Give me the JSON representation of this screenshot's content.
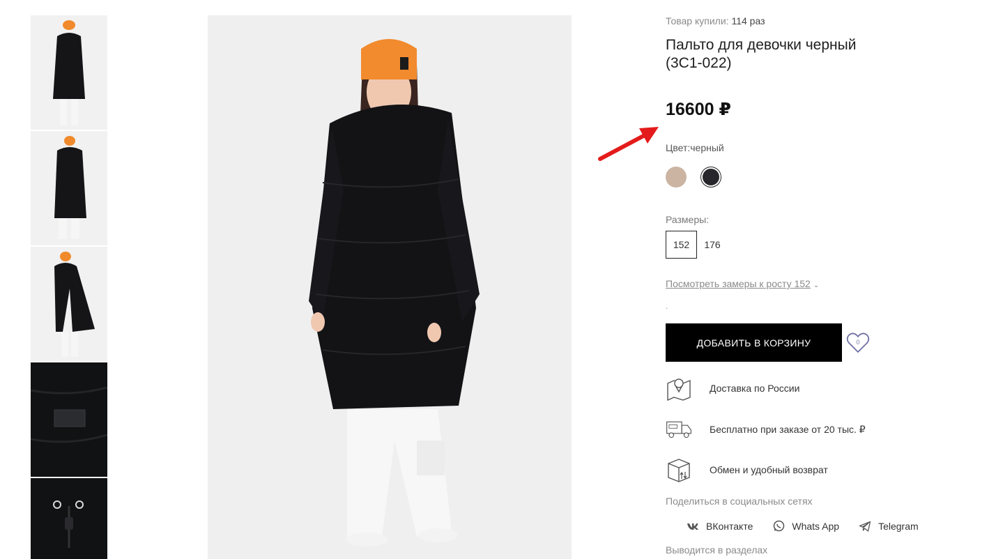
{
  "product": {
    "bought_label": "Товар купили:",
    "bought_count": "114 раз",
    "title": "Пальто для девочки черный (3С1-022)",
    "price": "16600 ₽",
    "color_label": "Цвет:черный",
    "colors": [
      {
        "name": "beige",
        "hex": "#cbb4a2"
      },
      {
        "name": "black",
        "hex": "#26262b",
        "selected": true
      }
    ],
    "sizes_label": "Размеры:",
    "sizes": [
      "152",
      "176"
    ],
    "selected_size": "152",
    "measure_link": "Посмотреть замеры к росту 152",
    "dot": ".",
    "add_to_cart": "ДОБАВИТЬ В КОРЗИНУ",
    "favorites_count": "0"
  },
  "features": [
    {
      "icon": "map-pin-icon",
      "text": "Доставка по России"
    },
    {
      "icon": "free-delivery-truck-icon",
      "text": "Бесплатно при заказе от 20 тыс. ₽"
    },
    {
      "icon": "box-exchange-icon",
      "text": "Обмен и удобный возврат"
    }
  ],
  "share": {
    "label": "Поделиться в социальных сетях",
    "networks": [
      {
        "icon": "vk-icon",
        "label": "ВКонтакте"
      },
      {
        "icon": "whatsapp-icon",
        "label": "Whats App"
      },
      {
        "icon": "telegram-icon",
        "label": "Telegram"
      }
    ]
  },
  "sections_label": "Выводится в разделах",
  "colors": {
    "accent": "#000000",
    "annotation_arrow": "#e41b1b",
    "muted_text": "#8a8a8a"
  }
}
